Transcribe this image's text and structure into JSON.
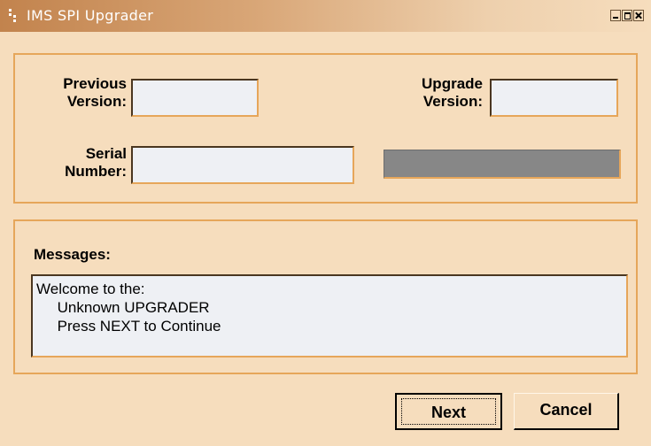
{
  "window": {
    "title": "IMS SPI Upgrader",
    "icon": "app-icon"
  },
  "form": {
    "previous_version_label_1": "Previous",
    "previous_version_label_2": "Version:",
    "previous_version_value": "",
    "upgrade_version_label_1": "Upgrade",
    "upgrade_version_label_2": "Version:",
    "upgrade_version_value": "",
    "serial_number_label_1": "Serial",
    "serial_number_label_2": "Number:",
    "serial_number_value": "",
    "progress_fraction": 0
  },
  "messages": {
    "heading": "Messages:",
    "lines": [
      "Welcome to the:",
      "     Unknown UPGRADER",
      "     Press NEXT to Continue"
    ]
  },
  "buttons": {
    "next": "Next",
    "cancel": "Cancel"
  },
  "colors": {
    "background": "#f6ddbd",
    "border_accent": "#e6a65a",
    "progress": "#878787"
  }
}
